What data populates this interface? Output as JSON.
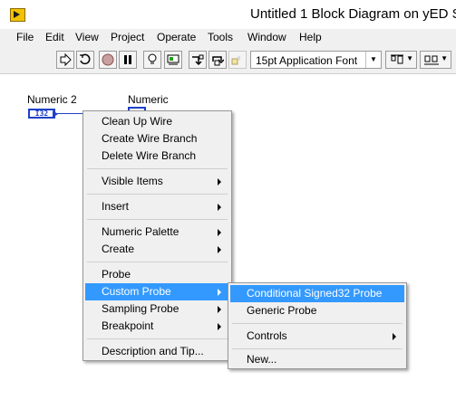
{
  "window": {
    "title": "Untitled 1 Block Diagram on yED S"
  },
  "menubar": {
    "items": [
      "File",
      "Edit",
      "View",
      "Project",
      "Operate",
      "Tools",
      "Window",
      "Help"
    ]
  },
  "toolbar": {
    "font_selector": "15pt Application Font",
    "buttons": [
      "run-arrow-icon",
      "run-continuous-icon",
      "abort-icon",
      "pause-icon",
      "highlight-execution-icon",
      "retain-wire-values-icon",
      "step-into-icon",
      "step-over-icon",
      "step-out-icon"
    ],
    "tools": [
      "align-objects-icon",
      "distribute-objects-icon"
    ]
  },
  "diagram": {
    "numeric2": {
      "label": "Numeric 2",
      "type": "I32"
    },
    "numeric": {
      "label": "Numeric"
    },
    "wire_color": "#1e40c8"
  },
  "context_menu": {
    "items": [
      "Clean Up Wire",
      "Create Wire Branch",
      "Delete Wire Branch",
      "Visible Items",
      "Insert",
      "Numeric Palette",
      "Create",
      "Probe",
      "Custom Probe",
      "Sampling Probe",
      "Breakpoint",
      "Description and Tip..."
    ]
  },
  "submenu": {
    "items": [
      "Conditional Signed32 Probe",
      "Generic Probe",
      "Controls",
      "New..."
    ]
  },
  "colors": {
    "highlight": "#3399ff",
    "menu_bg": "#f0f0f0"
  }
}
